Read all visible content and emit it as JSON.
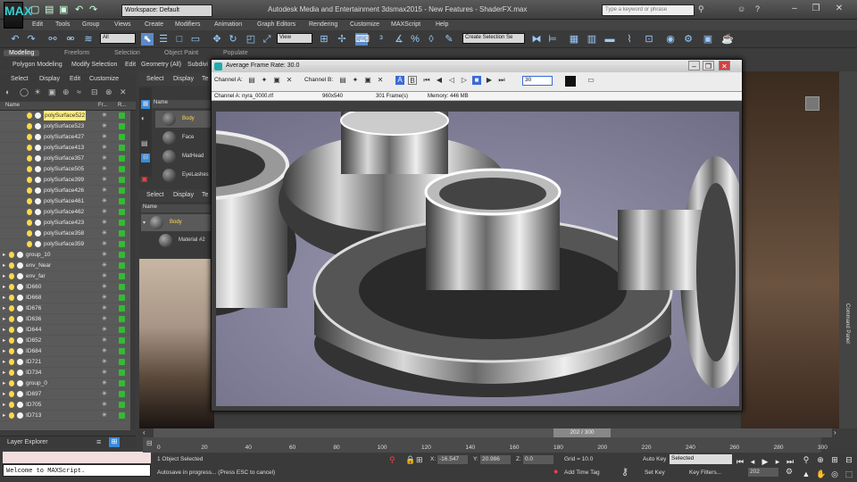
{
  "app": {
    "title": "Autodesk Media and Entertainment 3dsmax2015 - New Features - ShaderFX.max",
    "logo": "MAX",
    "workspace": "Workspace: Default",
    "search_placeholder": "Type a keyword or phrase",
    "window_buttons": [
      "–",
      "❐",
      "✕"
    ]
  },
  "menu": [
    "Edit",
    "Tools",
    "Group",
    "Views",
    "Create",
    "Modifiers",
    "Animation",
    "Graph Editors",
    "Rendering",
    "Customize",
    "MAXScript",
    "Help"
  ],
  "toolbar": {
    "filter": "All",
    "view": "View",
    "selection_set": "Create Selection Se"
  },
  "ribbon": {
    "tabs": [
      "Modeling",
      "Freeform",
      "Selection",
      "Object Paint",
      "Populate"
    ],
    "sub": [
      "Polygon Modeling",
      "Modify Selection",
      "Edit",
      "Geometry (All)",
      "Subdivi"
    ]
  },
  "scene_explorer": {
    "tabs": [
      "Select",
      "Display",
      "Edit",
      "Customize"
    ],
    "columns": [
      "Name",
      "Fr...",
      "R..."
    ],
    "rows": [
      {
        "name": "polySurface522",
        "type": "mesh",
        "selected": true
      },
      {
        "name": "polySurface523",
        "type": "mesh"
      },
      {
        "name": "polySurface427",
        "type": "mesh"
      },
      {
        "name": "polySurface413",
        "type": "mesh"
      },
      {
        "name": "polySurface357",
        "type": "mesh"
      },
      {
        "name": "polySurface505",
        "type": "mesh"
      },
      {
        "name": "polySurface399",
        "type": "mesh"
      },
      {
        "name": "polySurface426",
        "type": "mesh"
      },
      {
        "name": "polySurface461",
        "type": "mesh"
      },
      {
        "name": "polySurface462",
        "type": "mesh"
      },
      {
        "name": "polySurface423",
        "type": "mesh"
      },
      {
        "name": "polySurface358",
        "type": "mesh"
      },
      {
        "name": "polySurface359",
        "type": "mesh"
      },
      {
        "name": "group_10",
        "type": "group"
      },
      {
        "name": "env_Near",
        "type": "group"
      },
      {
        "name": "env_far",
        "type": "group"
      },
      {
        "name": "ID660",
        "type": "group"
      },
      {
        "name": "ID668",
        "type": "group"
      },
      {
        "name": "ID676",
        "type": "group"
      },
      {
        "name": "ID636",
        "type": "group"
      },
      {
        "name": "ID644",
        "type": "group"
      },
      {
        "name": "ID652",
        "type": "group"
      },
      {
        "name": "ID684",
        "type": "group"
      },
      {
        "name": "ID721",
        "type": "group"
      },
      {
        "name": "ID734",
        "type": "group"
      },
      {
        "name": "group_0",
        "type": "group"
      },
      {
        "name": "ID697",
        "type": "group"
      },
      {
        "name": "ID705",
        "type": "group"
      },
      {
        "name": "ID713",
        "type": "group"
      }
    ],
    "footer": "Layer Explorer"
  },
  "material_panel": {
    "tabs": [
      "Select",
      "Display",
      "Te"
    ],
    "column": "Name",
    "items": [
      "Body",
      "Face",
      "MatHead",
      "EyeLashes"
    ],
    "tabs2": [
      "Select",
      "Display",
      "Te"
    ],
    "column2": "Name",
    "body": "Body",
    "material": "Material #2"
  },
  "render_frame": {
    "title": "Average Frame Rate: 30.0",
    "channel_a": "Channel A:",
    "channel_b": "Channel B:",
    "frame_value": "30",
    "info_channel": "Channel A: nyra_0000.rlf",
    "info_size": "960x540",
    "info_frames": "301 Frame(s)",
    "info_memory": "Memory: 446 MB",
    "a_button": "A",
    "b_button": "B"
  },
  "timeline": {
    "position": "202 / 300",
    "ticks": [
      "0",
      "20",
      "40",
      "60",
      "80",
      "100",
      "120",
      "140",
      "160",
      "180",
      "200",
      "220",
      "240",
      "260",
      "280",
      "300"
    ]
  },
  "status": {
    "maxscript": "Welcome to MAXScript.",
    "selected": "1 Object Selected",
    "prompt": "Autosave in progress... (Press ESC to cancel)",
    "x_label": "X:",
    "x": "-16.547",
    "y_label": "Y:",
    "y": "20.986",
    "z_label": "Z:",
    "z": "0.0",
    "grid": "Grid = 10.0",
    "add_time_tag": "Add Time Tag",
    "auto_key": "Auto Key",
    "key_mode": "Selected",
    "set_key": "Set Key",
    "key_filters": "Key Filters...",
    "frame": "202"
  },
  "side": {
    "command_panel": "Command Panel"
  },
  "colors": {
    "accent": "#2aa8c8",
    "selected_row": "#fff07a",
    "visible_green": "#33bb33"
  }
}
